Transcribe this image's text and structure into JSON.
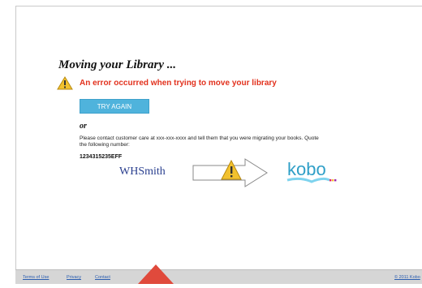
{
  "page": {
    "title": "Moving your Library ...",
    "error_message": "An error occurred when trying to move your library",
    "try_again_label": "TRY AGAIN",
    "or_label": "or",
    "contact_text": "Please contact customer care at xxx-xxx-xxxx and tell them that you were migrating your books. Quote the following number:",
    "reference_number": "1234315235EFF",
    "source_brand": "WHSmith",
    "target_brand": "kobo"
  },
  "footer": {
    "links": [
      "Terms of Use",
      "Privacy",
      "Contact"
    ],
    "copyright": "© 2011 Kobo"
  },
  "icons": {
    "error": "warning-icon",
    "transfer": "arrow-right-icon",
    "transfer_status": "warning-icon"
  },
  "colors": {
    "error_text": "#e2311d",
    "button": "#4fb3dc",
    "whsmith": "#2a3f8f",
    "kobo": "#2f9fc7",
    "warning": "#f2c12e",
    "footer_bg": "#d6d6d6",
    "pointer": "#e04a3c"
  }
}
